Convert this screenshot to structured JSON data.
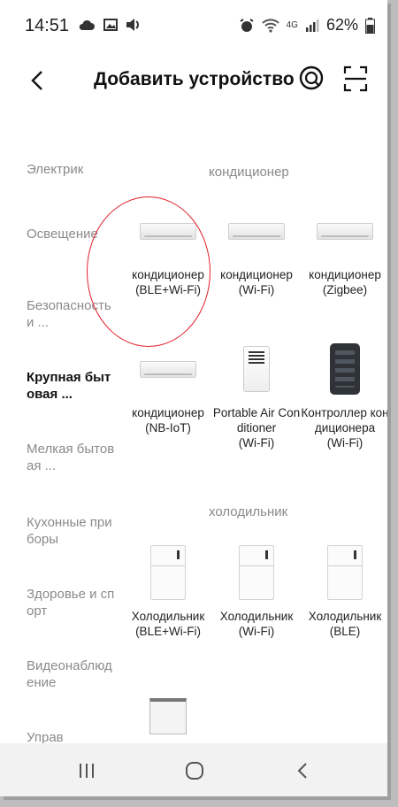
{
  "status_bar": {
    "time": "14:51",
    "battery": "62%",
    "network_label": "4G",
    "left_icons": [
      "cloud-icon",
      "image-icon",
      "volume-icon"
    ],
    "right_icons": [
      "alarm-icon",
      "wifi-icon",
      "signal-icon",
      "battery-icon"
    ]
  },
  "header": {
    "title": "Добавить устройство",
    "back_icon": "chevron-left-icon",
    "help_icon": "help-icon",
    "scan_icon": "scan-icon"
  },
  "sidebar": {
    "items": [
      {
        "label": "Электрик",
        "active": false
      },
      {
        "label": "Освещение",
        "active": false
      },
      {
        "label": "Безопасность и ...",
        "active": false
      },
      {
        "label": "Крупная бытовая ...",
        "active": true
      },
      {
        "label": "Мелкая бытовая ...",
        "active": false
      },
      {
        "label": "Кухонные приборы",
        "active": false
      },
      {
        "label": "Здоровье и спорт",
        "active": false
      },
      {
        "label": "Видеонаблюдение",
        "active": false
      },
      {
        "label": "Управ",
        "active": false
      }
    ]
  },
  "sections": {
    "ac_title": "кондиционер",
    "fridge_title": "холодильник"
  },
  "devices": {
    "ac_ble_wifi": {
      "name": "кондиционер",
      "proto": "(BLE+Wi-Fi)"
    },
    "ac_wifi": {
      "name": "кондиционер",
      "proto": "(Wi-Fi)"
    },
    "ac_zigbee": {
      "name": "кондиционер",
      "proto": "(Zigbee)"
    },
    "ac_nbiot": {
      "name": "кондиционер",
      "proto": "(NB-IoT)"
    },
    "portable_ac": {
      "name": "Portable Air Conditioner",
      "proto": "(Wi-Fi)"
    },
    "ac_controller": {
      "name": "Контроллер кондиционера",
      "proto": "(Wi-Fi)"
    },
    "fridge_ble_wifi": {
      "name": "Холодильник",
      "proto": "(BLE+Wi-Fi)"
    },
    "fridge_wifi": {
      "name": "Холодильник",
      "proto": "(Wi-Fi)"
    },
    "fridge_ble": {
      "name": "Холодильник",
      "proto": "(BLE)"
    }
  },
  "colors": {
    "accent_annotation": "#e0202a",
    "active_text": "#111111",
    "inactive_text": "#8a8a8a"
  },
  "nav_bar": {
    "recent_icon": "recent-apps-icon",
    "home_icon": "home-icon",
    "back_icon": "back-icon"
  }
}
